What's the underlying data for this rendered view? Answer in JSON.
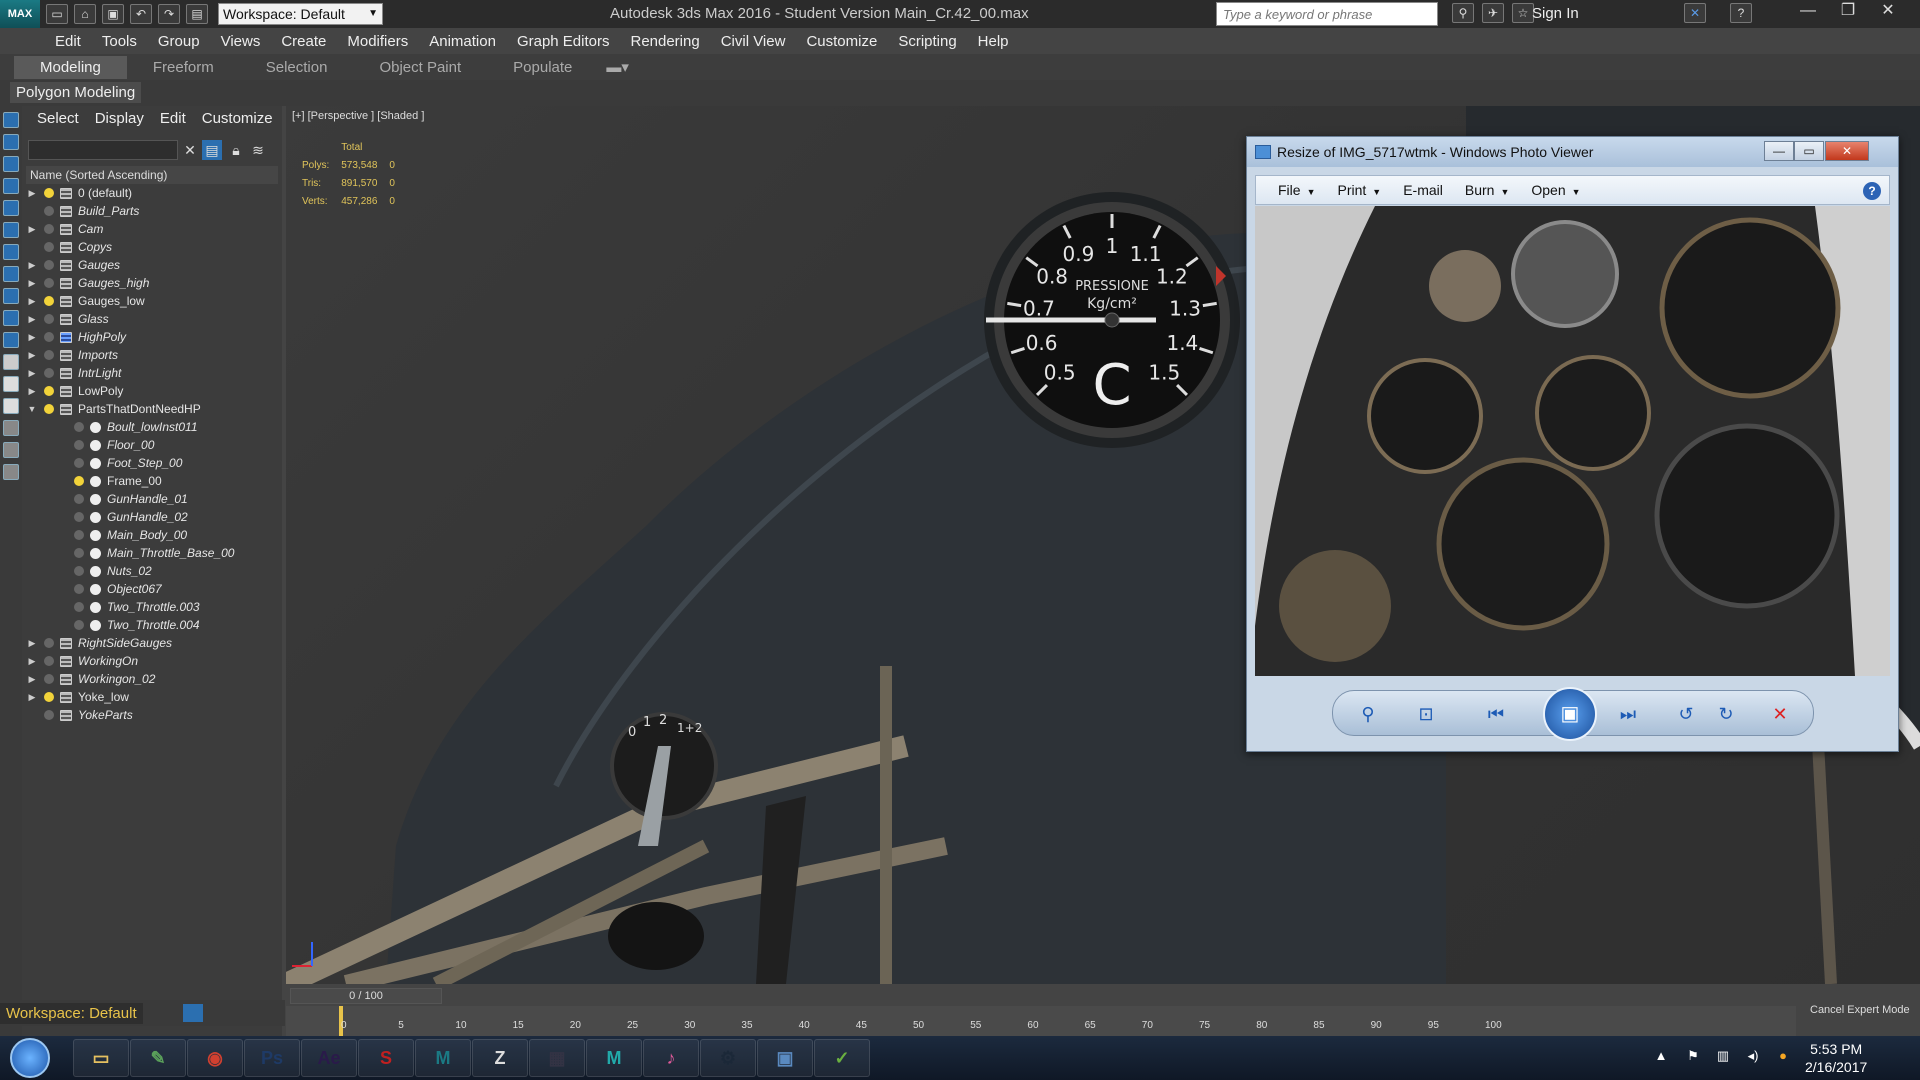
{
  "titlebar": {
    "app_icon": "3ds-max-icon",
    "app_icon_text": "MAX",
    "workspace": "Workspace: Default",
    "title": "Autodesk 3ds Max 2016 - Student Version     Main_Cr.42_00.max",
    "search_placeholder": "Type a keyword or phrase",
    "sign_in": "Sign In"
  },
  "menu": [
    "Edit",
    "Tools",
    "Group",
    "Views",
    "Create",
    "Modifiers",
    "Animation",
    "Graph Editors",
    "Rendering",
    "Civil View",
    "Customize",
    "Scripting",
    "Help"
  ],
  "ribbon": {
    "tabs": [
      "Modeling",
      "Freeform",
      "Selection",
      "Object Paint",
      "Populate"
    ],
    "active_tab": "Modeling",
    "sub_label": "Polygon Modeling"
  },
  "explorer": {
    "menu": [
      "Select",
      "Display",
      "Edit",
      "Customize"
    ],
    "column_header": "Name (Sorted Ascending)",
    "rows": [
      {
        "label": "0 (default)",
        "type": "layer",
        "expand": "▶",
        "bulb": true,
        "italic": false,
        "indent": false
      },
      {
        "label": "Build_Parts",
        "type": "layer",
        "expand": "",
        "bulb": false,
        "italic": true,
        "indent": false
      },
      {
        "label": "Cam",
        "type": "layer",
        "expand": "▶",
        "bulb": false,
        "italic": true,
        "indent": false
      },
      {
        "label": "Copys",
        "type": "layer",
        "expand": "",
        "bulb": false,
        "italic": true,
        "indent": false
      },
      {
        "label": "Gauges",
        "type": "layer",
        "expand": "▶",
        "bulb": false,
        "italic": true,
        "indent": false
      },
      {
        "label": "Gauges_high",
        "type": "layer",
        "expand": "▶",
        "bulb": false,
        "italic": true,
        "indent": false
      },
      {
        "label": "Gauges_low",
        "type": "layer",
        "expand": "▶",
        "bulb": true,
        "italic": false,
        "indent": false
      },
      {
        "label": "Glass",
        "type": "layer",
        "expand": "▶",
        "bulb": false,
        "italic": true,
        "indent": false
      },
      {
        "label": "HighPoly",
        "type": "layer-hp",
        "expand": "▶",
        "bulb": false,
        "italic": true,
        "indent": false
      },
      {
        "label": "Imports",
        "type": "layer",
        "expand": "▶",
        "bulb": false,
        "italic": true,
        "indent": false
      },
      {
        "label": "IntrLight",
        "type": "layer",
        "expand": "▶",
        "bulb": false,
        "italic": true,
        "indent": false
      },
      {
        "label": "LowPoly",
        "type": "layer",
        "expand": "▶",
        "bulb": true,
        "italic": false,
        "indent": false
      },
      {
        "label": "PartsThatDontNeedHP",
        "type": "layer",
        "expand": "▼",
        "bulb": true,
        "italic": false,
        "indent": false
      },
      {
        "label": "Boult_lowInst011",
        "type": "obj",
        "expand": "",
        "bulb": false,
        "italic": true,
        "indent": true
      },
      {
        "label": "Floor_00",
        "type": "obj",
        "expand": "",
        "bulb": false,
        "italic": true,
        "indent": true
      },
      {
        "label": "Foot_Step_00",
        "type": "obj",
        "expand": "",
        "bulb": false,
        "italic": true,
        "indent": true
      },
      {
        "label": "Frame_00",
        "type": "obj",
        "expand": "",
        "bulb": true,
        "italic": false,
        "indent": true
      },
      {
        "label": "GunHandle_01",
        "type": "obj",
        "expand": "",
        "bulb": false,
        "italic": true,
        "indent": true
      },
      {
        "label": "GunHandle_02",
        "type": "obj",
        "expand": "",
        "bulb": false,
        "italic": true,
        "indent": true
      },
      {
        "label": "Main_Body_00",
        "type": "obj",
        "expand": "",
        "bulb": false,
        "italic": true,
        "indent": true
      },
      {
        "label": "Main_Throttle_Base_00",
        "type": "obj",
        "expand": "",
        "bulb": false,
        "italic": true,
        "indent": true
      },
      {
        "label": "Nuts_02",
        "type": "obj",
        "expand": "",
        "bulb": false,
        "italic": true,
        "indent": true
      },
      {
        "label": "Object067",
        "type": "obj",
        "expand": "",
        "bulb": false,
        "italic": true,
        "indent": true
      },
      {
        "label": "Two_Throttle.003",
        "type": "obj",
        "expand": "",
        "bulb": false,
        "italic": true,
        "indent": true
      },
      {
        "label": "Two_Throttle.004",
        "type": "obj",
        "expand": "",
        "bulb": false,
        "italic": true,
        "indent": true
      },
      {
        "label": "RightSideGauges",
        "type": "layer",
        "expand": "▶",
        "bulb": false,
        "italic": true,
        "indent": false
      },
      {
        "label": "WorkingOn",
        "type": "layer",
        "expand": "▶",
        "bulb": false,
        "italic": true,
        "indent": false
      },
      {
        "label": "Workingon_02",
        "type": "layer",
        "expand": "▶",
        "bulb": false,
        "italic": true,
        "indent": false
      },
      {
        "label": "Yoke_low",
        "type": "layer",
        "expand": "▶",
        "bulb": true,
        "italic": false,
        "indent": false
      },
      {
        "label": "YokeParts",
        "type": "layer",
        "expand": "",
        "bulb": false,
        "italic": true,
        "indent": false
      }
    ]
  },
  "viewport": {
    "label": "[+] [Perspective ] [Shaded ]",
    "stats_header": "Total",
    "stats": [
      {
        "name": "Polys:",
        "total": "573,548",
        "sel": "0"
      },
      {
        "name": "Tris:",
        "total": "891,570",
        "sel": "0"
      },
      {
        "name": "Verts:",
        "total": "457,286",
        "sel": "0"
      }
    ],
    "gauge_title": "PRESSIONE",
    "gauge_unit": "Kg/cm²",
    "gauge_letter": "C",
    "gauge_ticks": [
      "0.5",
      "0.6",
      "0.7",
      "0.8",
      "0.9",
      "1",
      "1.1",
      "1.2",
      "1.3",
      "1.4",
      "1.5"
    ],
    "throttle_marks": [
      "0",
      "1",
      "2",
      "1+2"
    ]
  },
  "photo_viewer": {
    "title": "Resize of IMG_5717wtmk - Windows Photo Viewer",
    "menu": [
      {
        "label": "File",
        "dropdown": true
      },
      {
        "label": "Print",
        "dropdown": true
      },
      {
        "label": "E-mail",
        "dropdown": false
      },
      {
        "label": "Burn",
        "dropdown": true
      },
      {
        "label": "Open",
        "dropdown": true
      }
    ],
    "controls": [
      "zoom-icon",
      "actual-size-icon",
      "previous-icon",
      "slideshow-icon",
      "next-icon",
      "rotate-left-icon",
      "rotate-right-icon",
      "delete-icon"
    ]
  },
  "bottom": {
    "workspace": "Workspace: Default",
    "time_slider": "0 / 100",
    "ticks": [
      "0",
      "5",
      "10",
      "15",
      "20",
      "25",
      "30",
      "35",
      "40",
      "45",
      "50",
      "55",
      "60",
      "65",
      "70",
      "75",
      "80",
      "85",
      "90",
      "95",
      "100"
    ],
    "cancel_expert": "Cancel Expert Mode"
  },
  "taskbar": {
    "apps": [
      "Explorer",
      "Notepad",
      "Chrome",
      "Ps",
      "Ae",
      "Substance",
      "3ds Max",
      "ZBrush",
      "Movie Maker",
      "Maya",
      "iTunes",
      "Steam",
      "Photo Viewer",
      "Green"
    ],
    "time": "5:53 PM",
    "date": "2/16/2017"
  },
  "colors": {
    "ui_dark": "#444444",
    "bulb_on": "#f2d33a",
    "stats": "#e0c45a",
    "pv_frame": "#c9d7e6"
  }
}
